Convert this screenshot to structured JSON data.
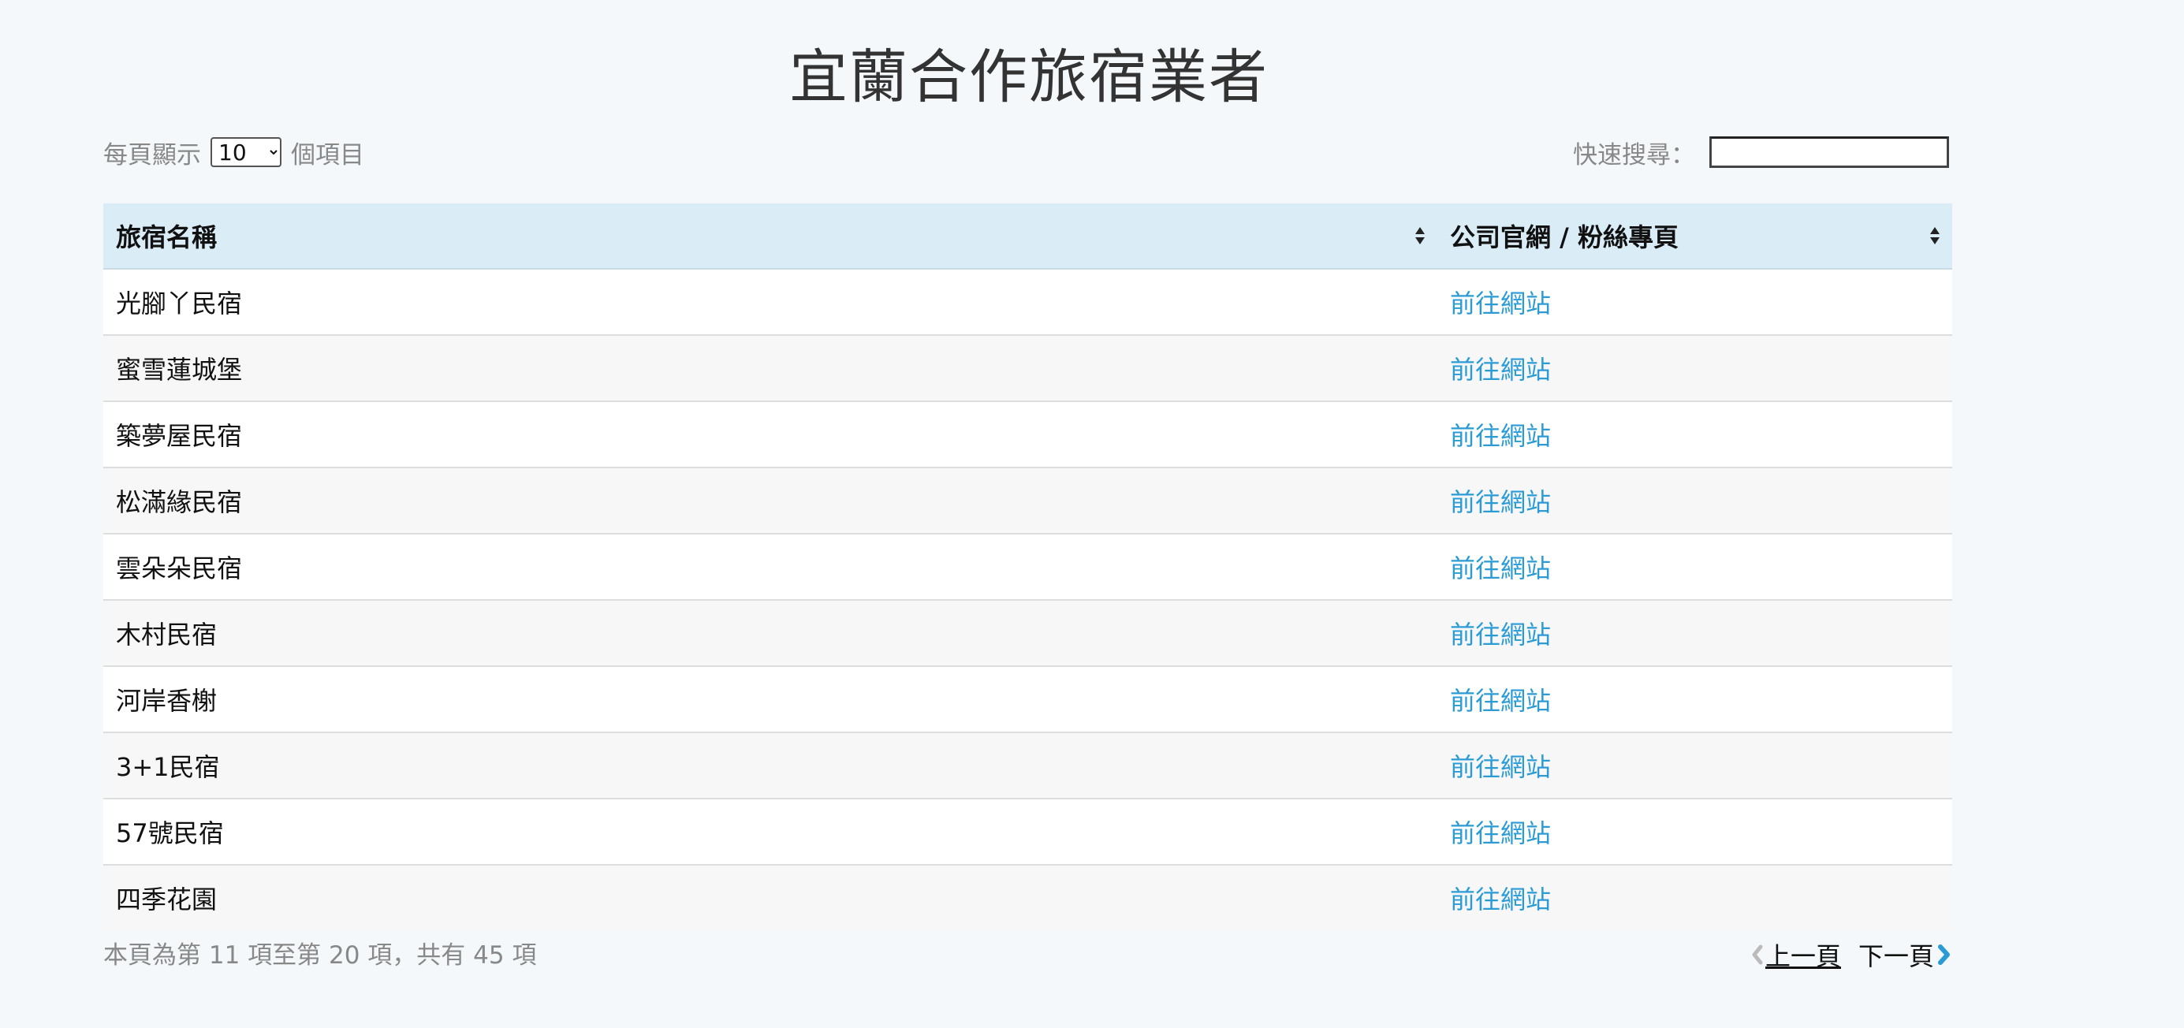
{
  "page_title": "宜蘭合作旅宿業者",
  "length": {
    "prefix": "每頁顯示",
    "selected": "10",
    "suffix": "個項目"
  },
  "search": {
    "label": "快速搜尋：",
    "value": ""
  },
  "table": {
    "headers": [
      "旅宿名稱",
      "公司官網 / 粉絲專頁"
    ],
    "rows": [
      {
        "name": "光腳丫民宿",
        "link": "前往網站"
      },
      {
        "name": "蜜雪蓮城堡",
        "link": "前往網站"
      },
      {
        "name": "築夢屋民宿",
        "link": "前往網站"
      },
      {
        "name": "松滿緣民宿",
        "link": "前往網站"
      },
      {
        "name": "雲朵朵民宿",
        "link": "前往網站"
      },
      {
        "name": "木村民宿",
        "link": "前往網站"
      },
      {
        "name": "河岸香榭",
        "link": "前往網站"
      },
      {
        "name": "3+1民宿",
        "link": "前往網站"
      },
      {
        "name": "57號民宿",
        "link": "前往網站"
      },
      {
        "name": "四季花園",
        "link": "前往網站"
      }
    ]
  },
  "info": "本頁為第 11 項至第 20 項，共有 45 項",
  "pagination": {
    "prev": "上一頁",
    "next": "下一頁"
  },
  "colors": {
    "header_bg": "#daedf7",
    "link": "#2b9bd6",
    "page_bg": "#f4f8fb"
  }
}
